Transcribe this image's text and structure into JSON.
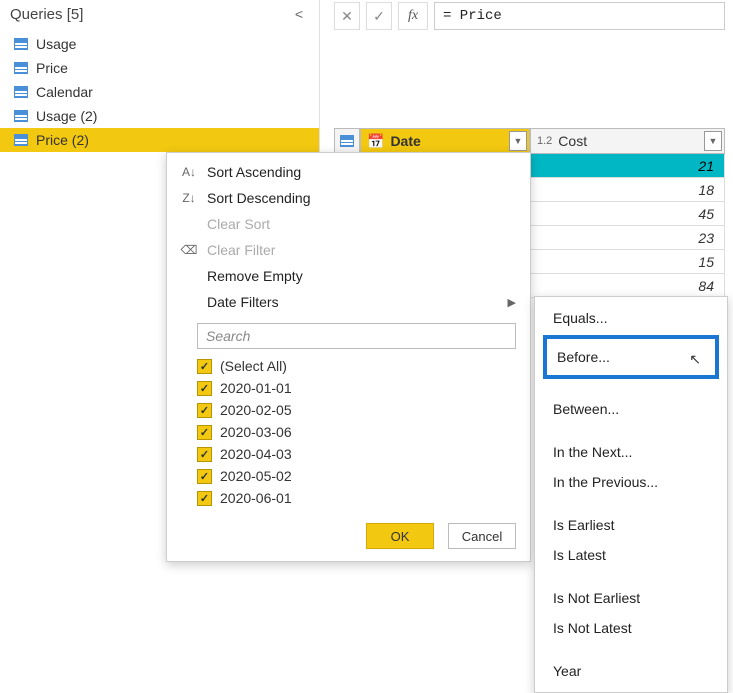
{
  "queriesPanel": {
    "title": "Queries [5]",
    "items": [
      {
        "label": "Usage",
        "selected": false
      },
      {
        "label": "Price",
        "selected": false
      },
      {
        "label": "Calendar",
        "selected": false
      },
      {
        "label": "Usage (2)",
        "selected": false
      },
      {
        "label": "Price (2)",
        "selected": true
      }
    ]
  },
  "formulaBar": {
    "fx": "fx",
    "text": "= Price"
  },
  "columns": {
    "date": {
      "type": "",
      "label": "Date"
    },
    "cost": {
      "type": "1.2",
      "label": "Cost"
    }
  },
  "rows": [
    {
      "cost": "21"
    },
    {
      "cost": "18"
    },
    {
      "cost": "45"
    },
    {
      "cost": "23"
    },
    {
      "cost": "15"
    },
    {
      "cost": "84"
    }
  ],
  "contextMenu": {
    "sortAsc": "Sort Ascending",
    "sortDesc": "Sort Descending",
    "clearSort": "Clear Sort",
    "clearFilter": "Clear Filter",
    "removeEmpty": "Remove Empty",
    "dateFilters": "Date Filters",
    "searchPlaceholder": "Search",
    "values": [
      "(Select All)",
      "2020-01-01",
      "2020-02-05",
      "2020-03-06",
      "2020-04-03",
      "2020-05-02",
      "2020-06-01"
    ],
    "ok": "OK",
    "cancel": "Cancel"
  },
  "dateFiltersSubmenu": {
    "equals": "Equals...",
    "before": "Before...",
    "between": "Between...",
    "inTheNext": "In the Next...",
    "inThePrevious": "In the Previous...",
    "isEarliest": "Is Earliest",
    "isLatest": "Is Latest",
    "isNotEarliest": "Is Not Earliest",
    "isNotLatest": "Is Not Latest",
    "year": "Year"
  }
}
